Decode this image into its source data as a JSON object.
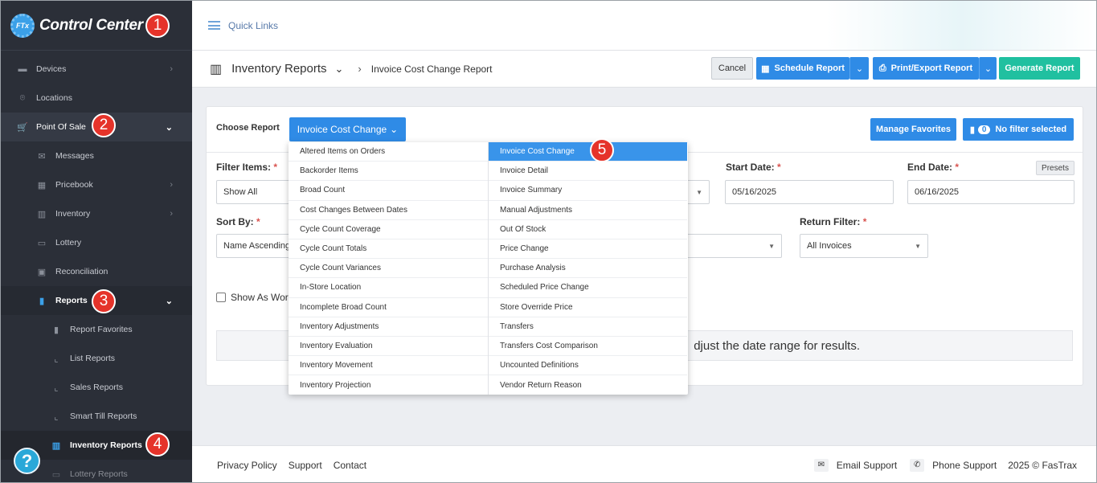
{
  "app": {
    "title": "Control Center",
    "logo_text": "FTx"
  },
  "badges": [
    "1",
    "2",
    "3",
    "4",
    "5"
  ],
  "sidebar": {
    "items": [
      {
        "label": "Devices",
        "icon": "devices-icon"
      },
      {
        "label": "Locations",
        "icon": "location-icon"
      },
      {
        "label": "Point Of Sale",
        "icon": "cart-icon"
      },
      {
        "label": "Messages",
        "icon": "messages-icon"
      },
      {
        "label": "Pricebook",
        "icon": "pricebook-icon"
      },
      {
        "label": "Inventory",
        "icon": "inventory-icon"
      },
      {
        "label": "Lottery",
        "icon": "lottery-icon"
      },
      {
        "label": "Reconciliation",
        "icon": "reconciliation-icon"
      },
      {
        "label": "Reports",
        "icon": "reports-icon"
      },
      {
        "label": "Report Favorites",
        "icon": "bookmark-icon"
      },
      {
        "label": "List Reports",
        "icon": "chart-icon"
      },
      {
        "label": "Sales Reports",
        "icon": "chart-icon"
      },
      {
        "label": "Smart Till Reports",
        "icon": "chart-icon"
      },
      {
        "label": "Inventory Reports",
        "icon": "inventory-report-icon"
      },
      {
        "label": "Lottery Reports",
        "icon": "lottery-icon"
      }
    ],
    "help_label": "?"
  },
  "topbar": {
    "quick_links": "Quick Links"
  },
  "header": {
    "title": "Inventory Reports",
    "breadcrumb": "Invoice Cost Change Report",
    "cancel": "Cancel",
    "schedule": "Schedule Report",
    "print": "Print/Export Report",
    "generate": "Generate Report"
  },
  "card": {
    "choose_report_label": "Choose Report",
    "choose_report_value": "Invoice Cost Change",
    "manage_favorites": "Manage Favorites",
    "filter_count": "0",
    "filter_status": "No filter selected",
    "filter_items_label": "Filter Items:",
    "filter_items_value": "Show All",
    "start_date_label": "Start Date:",
    "start_date_value": "05/16/2025",
    "end_date_label": "End Date:",
    "end_date_value": "06/16/2025",
    "presets": "Presets",
    "sort_by_label": "Sort By:",
    "sort_by_value": "Name Ascending",
    "return_filter_label": "Return Filter:",
    "return_filter_value": "All Invoices",
    "show_as_label": "Show As Work",
    "message": "djust the date range for results.",
    "required_mark": "*"
  },
  "dropdown": {
    "left": [
      "Altered Items on Orders",
      "Backorder Items",
      "Broad Count",
      "Cost Changes Between Dates",
      "Cycle Count Coverage",
      "Cycle Count Totals",
      "Cycle Count Variances",
      "In-Store Location",
      "Incomplete Broad Count",
      "Inventory Adjustments",
      "Inventory Evaluation",
      "Inventory Movement",
      "Inventory Projection"
    ],
    "right": [
      "Invoice Cost Change",
      "Invoice Detail",
      "Invoice Summary",
      "Manual Adjustments",
      "Out Of Stock",
      "Price Change",
      "Purchase Analysis",
      "Scheduled Price Change",
      "Store Override Price",
      "Transfers",
      "Transfers Cost Comparison",
      "Uncounted Definitions",
      "Vendor Return Reason"
    ],
    "selected": "Invoice Cost Change"
  },
  "footer": {
    "privacy": "Privacy Policy",
    "support": "Support",
    "contact": "Contact",
    "email_support": "Email Support",
    "phone_support": "Phone Support",
    "copyright": "2025 © FasTrax"
  },
  "colors": {
    "primary": "#2f8be6",
    "success": "#20c0a0",
    "sidebar": "#2b2f38",
    "badge": "#e5332a"
  }
}
